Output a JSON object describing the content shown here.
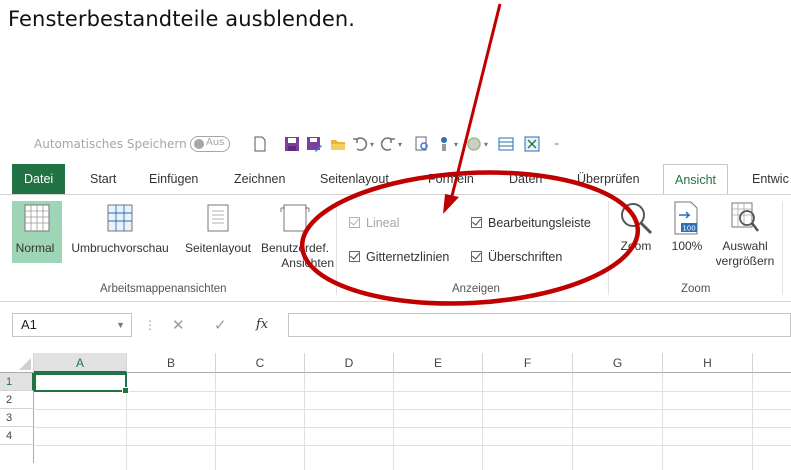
{
  "caption": "Fensterbestandteile ausblenden.",
  "qat": {
    "autosave_label": "Automatisches Speichern",
    "autosave_state": "Aus",
    "icons": [
      "new-file-icon",
      "save-icon",
      "save-as-icon",
      "open-folder-icon",
      "undo-icon",
      "redo-icon",
      "print-preview-icon",
      "touch-mode-icon",
      "color-icon",
      "form-icon",
      "table-icon",
      "customize-icon"
    ]
  },
  "tabs": [
    "Datei",
    "Start",
    "Einfügen",
    "Zeichnen",
    "Seitenlayout",
    "Formeln",
    "Daten",
    "Überprüfen",
    "Ansicht",
    "Entwic"
  ],
  "active_tab": "Ansicht",
  "ribbon": {
    "views": {
      "normal": "Normal",
      "pagebreak": "Umbruchvorschau",
      "pagelayout": "Seitenlayout",
      "custom_line1": "Benutzerdef.",
      "custom_line2": "Ansichten",
      "group_label": "Arbeitsmappenansichten"
    },
    "show": {
      "lineal": "Lineal",
      "gitternetz": "Gitternetzlinien",
      "bearbeitung": "Bearbeitungsleiste",
      "ueberschriften": "Überschriften",
      "group_label": "Anzeigen"
    },
    "zoom": {
      "zoom": "Zoom",
      "hundred": "100%",
      "auswahl_line1": "Auswahl",
      "auswahl_line2": "vergrößern",
      "group_label": "Zoom",
      "badge": "100"
    }
  },
  "formula_bar": {
    "name_box": "A1",
    "cancel": "✕",
    "enter": "✓",
    "fx": "fx",
    "value": ""
  },
  "grid": {
    "columns": [
      "A",
      "B",
      "C",
      "D",
      "E",
      "F",
      "G",
      "H"
    ],
    "rows": [
      "1",
      "2",
      "3",
      "4"
    ],
    "active_cell": "A1"
  },
  "colors": {
    "excel_green": "#217346",
    "selected_view": "#9fd5b7",
    "annotation_red": "#c00000"
  }
}
